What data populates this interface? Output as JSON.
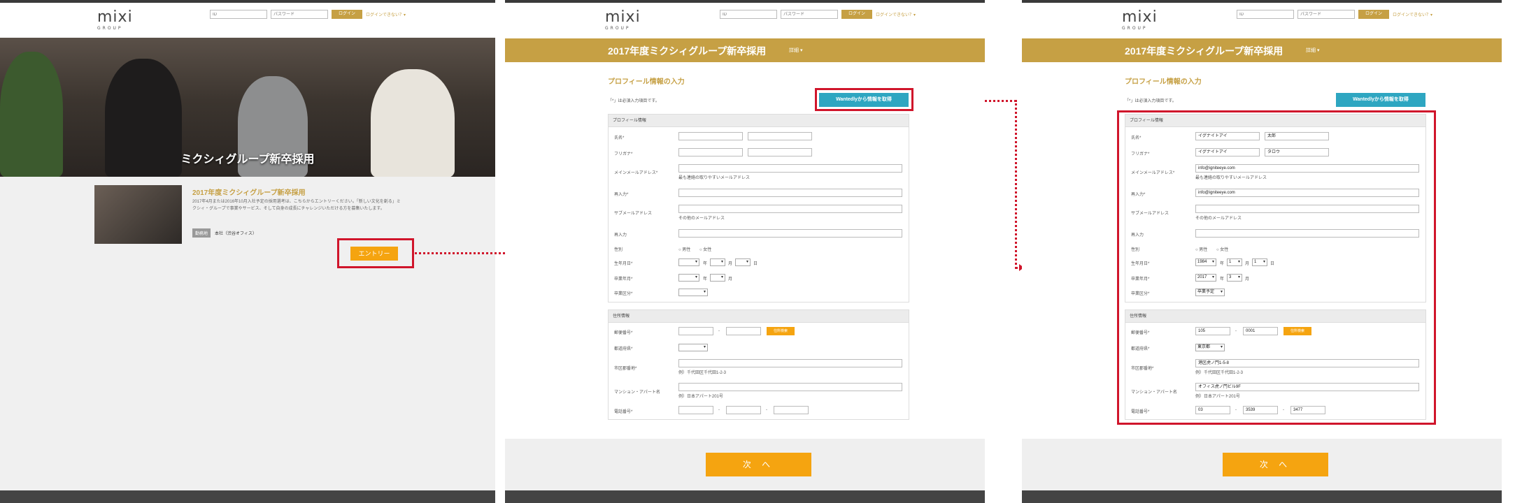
{
  "header": {
    "logo_main": "mixi",
    "logo_sub": "GROUP",
    "id_placeholder": "ID",
    "pw_placeholder": "パスワード",
    "login_label": "ログイン",
    "forgot_label": "ログインできない？▾"
  },
  "landing": {
    "hero_title": "ミクシィグループ新卒採用",
    "info_title": "2017年度ミクシィグループ新卒採用",
    "info_desc": "2017年4月または2016年10月入社予定の採用選考は、こちらからエントリーください。「新しい文化を創る」ミクシィ・グループで事業やサービス、そして自身の成長にチャレンジいただける方を募集いたします。",
    "tag_label": "勤務地",
    "tag_value": "本社（渋谷オフィス）",
    "entry_button": "エントリー"
  },
  "form": {
    "band_title": "2017年度ミクシィグループ新卒採用",
    "band_detail": "詳細 ▾",
    "section_title": "プロフィール情報の入力",
    "required_note": "「*」は必須入力項目です。",
    "wantedly_button": "Wantedlyから情報を取得",
    "profile_header": "プロフィール情報",
    "address_header": "住所情報",
    "labels": {
      "name": "氏名*",
      "kana": "フリガナ*",
      "main_email": "メインメールアドレス*",
      "main_email_hint": "最も連絡の取りやすいメールアドレス",
      "reenter": "再入力*",
      "sub_email": "サブメールアドレス",
      "sub_email_hint": "その他のメールアドレス",
      "reenter2": "再入力",
      "gender": "性別",
      "male": "男性",
      "female": "女性",
      "birthdate": "生年月日*",
      "grad_date": "卒業年月*",
      "grad_type": "卒業区分*",
      "year": "年",
      "month": "月",
      "day": "日",
      "postal": "郵便番号*",
      "postal_search": "住所検索",
      "prefecture": "都道府県*",
      "city": "市区郡番地*",
      "city_hint": "例）千代田区千代田1-2-3",
      "building": "マンション・アパート名",
      "building_hint": "例）日本アパート201号",
      "phone": "電話番号*",
      "dash": "-"
    },
    "next_button": "次 へ"
  },
  "filled": {
    "last_name": "イグナイトアイ",
    "first_name": "太郎",
    "last_kana": "イグナイトアイ",
    "first_kana": "タロウ",
    "email": "info@igniteeye.com",
    "email_confirm": "info@igniteeye.com",
    "birth_year": "1984",
    "birth_month": "1",
    "birth_day": "1",
    "grad_year": "2017",
    "grad_month": "3",
    "grad_type": "卒業予定",
    "postal1": "105",
    "postal2": "0001",
    "prefecture": "東京都",
    "city": "港区虎ノ門1-5-8",
    "building": "オフィス虎ノ門ビル9F",
    "phone1": "03",
    "phone2": "3539",
    "phone3": "3477"
  },
  "colors": {
    "gold": "#c6a044",
    "orange": "#f5a410",
    "teal": "#2ea6c1",
    "highlight_red": "#d0152b"
  }
}
